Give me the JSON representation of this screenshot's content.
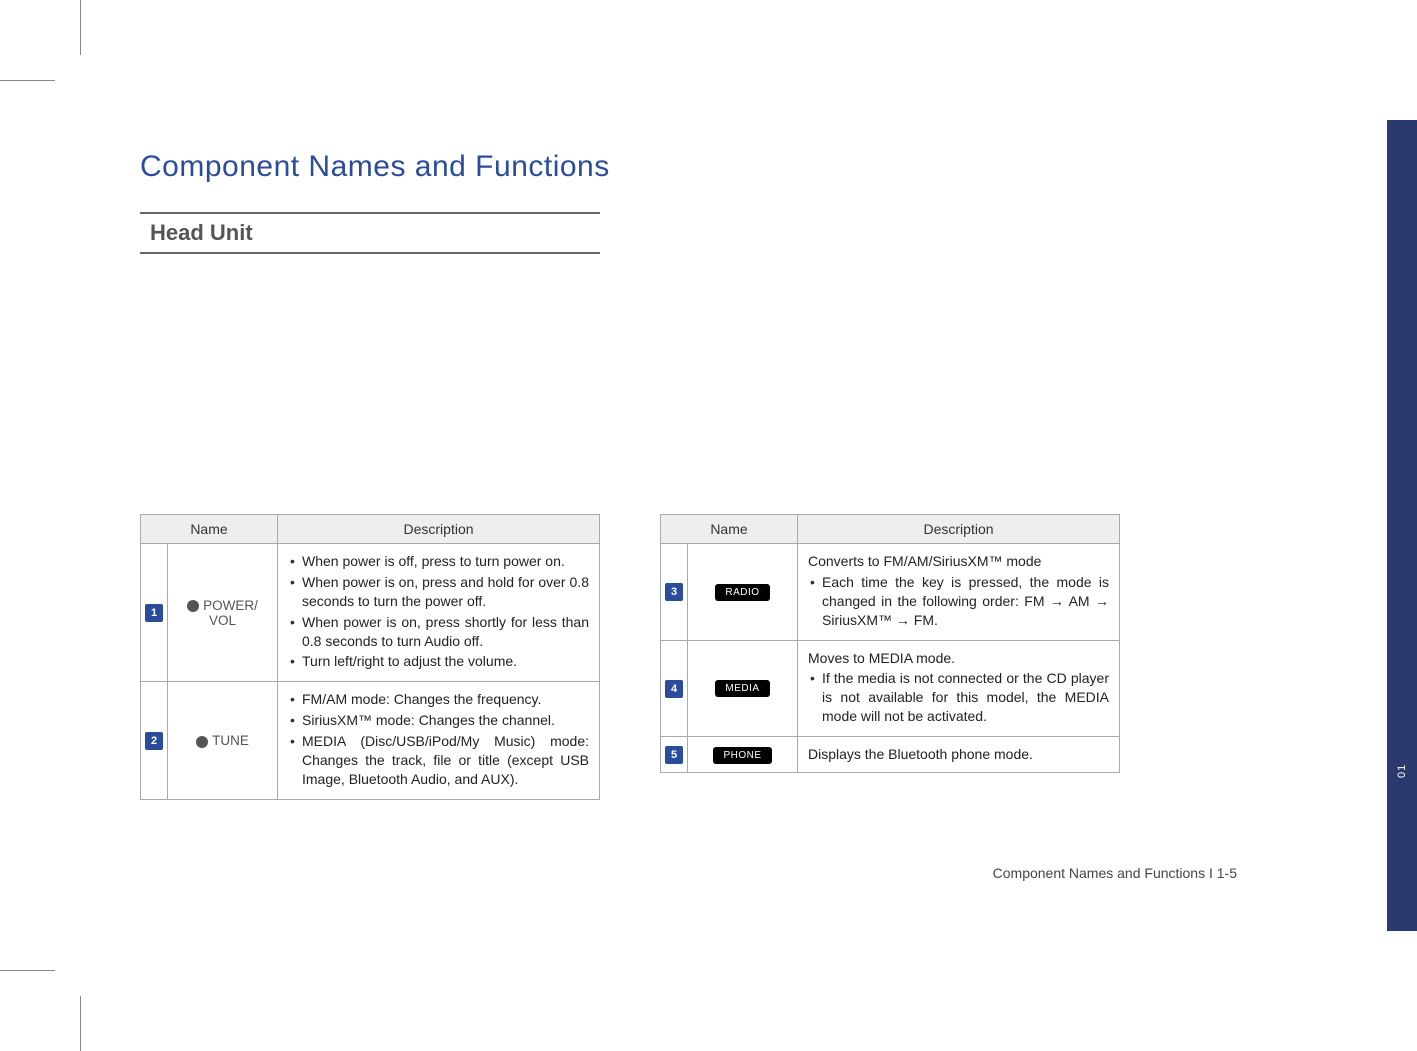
{
  "section_title": "Component Names and Functions",
  "sub_heading": "Head Unit",
  "table_headers": {
    "name": "Name",
    "description": "Description"
  },
  "left_rows": [
    {
      "idx": "1",
      "name": "POWER/\nVOL",
      "icon_type": "knob",
      "desc_items": [
        "When power is off, press to turn power on.",
        "When power is on, press and hold for over 0.8 seconds to turn the power off.",
        "When power is on, press shortly for less than 0.8 seconds to turn Audio off.",
        "Turn left/right to adjust the volume."
      ]
    },
    {
      "idx": "2",
      "name": "TUNE",
      "icon_type": "knob",
      "desc_items": [
        "FM/AM mode: Changes the frequency.",
        "SiriusXM™ mode: Changes the channel.",
        "MEDIA (Disc/USB/iPod/My Music) mode: Changes the track, file or title (except USB Image, Bluetooth Audio, and AUX)."
      ]
    }
  ],
  "right_rows": [
    {
      "idx": "3",
      "name": "RADIO",
      "icon_type": "button",
      "desc_intro": "Converts to FM/AM/SiriusXM™ mode",
      "desc_items": [
        "Each time the key is pressed, the mode is changed in the following order: FM → AM →  SiriusXM™ → FM."
      ]
    },
    {
      "idx": "4",
      "name": "MEDIA",
      "icon_type": "button",
      "desc_intro": "Moves to MEDIA mode.",
      "desc_items": [
        "If the media is not connected or the CD player is not available for this model, the MEDIA mode will not be activated."
      ]
    },
    {
      "idx": "5",
      "name": "PHONE",
      "icon_type": "button",
      "desc_plain": "Displays the Bluetooth phone mode."
    }
  ],
  "footer": "Component Names and Functions I 1-5",
  "side_label": "01"
}
